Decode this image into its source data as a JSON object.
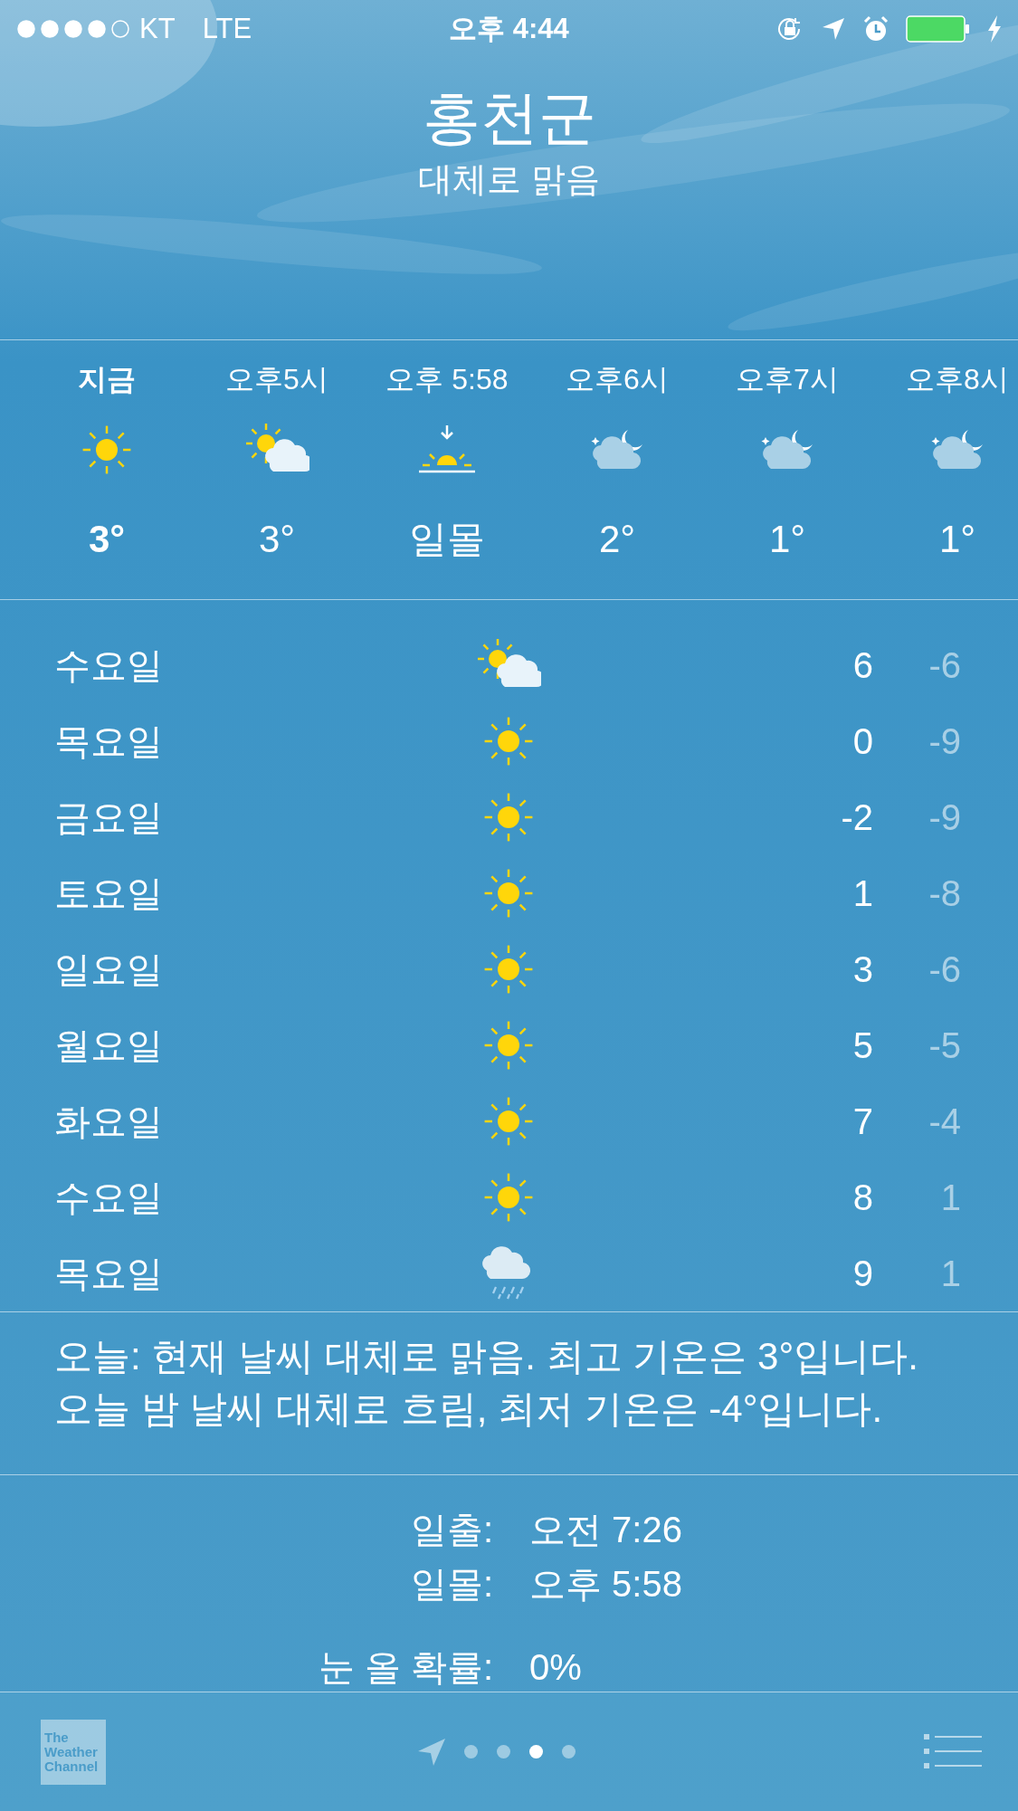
{
  "status_bar": {
    "carrier": "KT",
    "network": "LTE",
    "time": "오후 4:44"
  },
  "location": {
    "city": "홍천군",
    "condition": "대체로 맑음"
  },
  "hourly": [
    {
      "time": "지금",
      "kind": "sun",
      "temp": "3°",
      "current": true
    },
    {
      "time": "오후5시",
      "kind": "partly-cloudy",
      "temp": "3°",
      "current": false
    },
    {
      "time": "오후 5:58",
      "kind": "sunset",
      "temp": "일몰",
      "current": false
    },
    {
      "time": "오후6시",
      "kind": "night-cloudy",
      "temp": "2°",
      "current": false
    },
    {
      "time": "오후7시",
      "kind": "night-cloudy",
      "temp": "1°",
      "current": false
    },
    {
      "time": "오후8시",
      "kind": "night-cloudy",
      "temp": "1°",
      "current": false
    }
  ],
  "daily": [
    {
      "day": "수요일",
      "kind": "partly-cloudy",
      "high": "6",
      "low": "-6"
    },
    {
      "day": "목요일",
      "kind": "sun",
      "high": "0",
      "low": "-9"
    },
    {
      "day": "금요일",
      "kind": "sun",
      "high": "-2",
      "low": "-9"
    },
    {
      "day": "토요일",
      "kind": "sun",
      "high": "1",
      "low": "-8"
    },
    {
      "day": "일요일",
      "kind": "sun",
      "high": "3",
      "low": "-6"
    },
    {
      "day": "월요일",
      "kind": "sun",
      "high": "5",
      "low": "-5"
    },
    {
      "day": "화요일",
      "kind": "sun",
      "high": "7",
      "low": "-4"
    },
    {
      "day": "수요일",
      "kind": "sun",
      "high": "8",
      "low": "1"
    },
    {
      "day": "목요일",
      "kind": "rain",
      "high": "9",
      "low": "1"
    }
  ],
  "summary": "오늘: 현재 날씨 대체로 맑음. 최고 기온은 3°입니다. 오늘 밤 날씨 대체로 흐림, 최저 기온은 -4°입니다.",
  "details": [
    {
      "label": "일출:",
      "value": "오전 7:26"
    },
    {
      "label": "일몰:",
      "value": "오후 5:58"
    },
    {
      "label": "눈 올 확률:",
      "value": "0%"
    }
  ],
  "footer": {
    "logo": "The Weather Channel",
    "pages": [
      {
        "selected": false
      },
      {
        "selected": false
      },
      {
        "selected": true
      },
      {
        "selected": false
      }
    ]
  }
}
